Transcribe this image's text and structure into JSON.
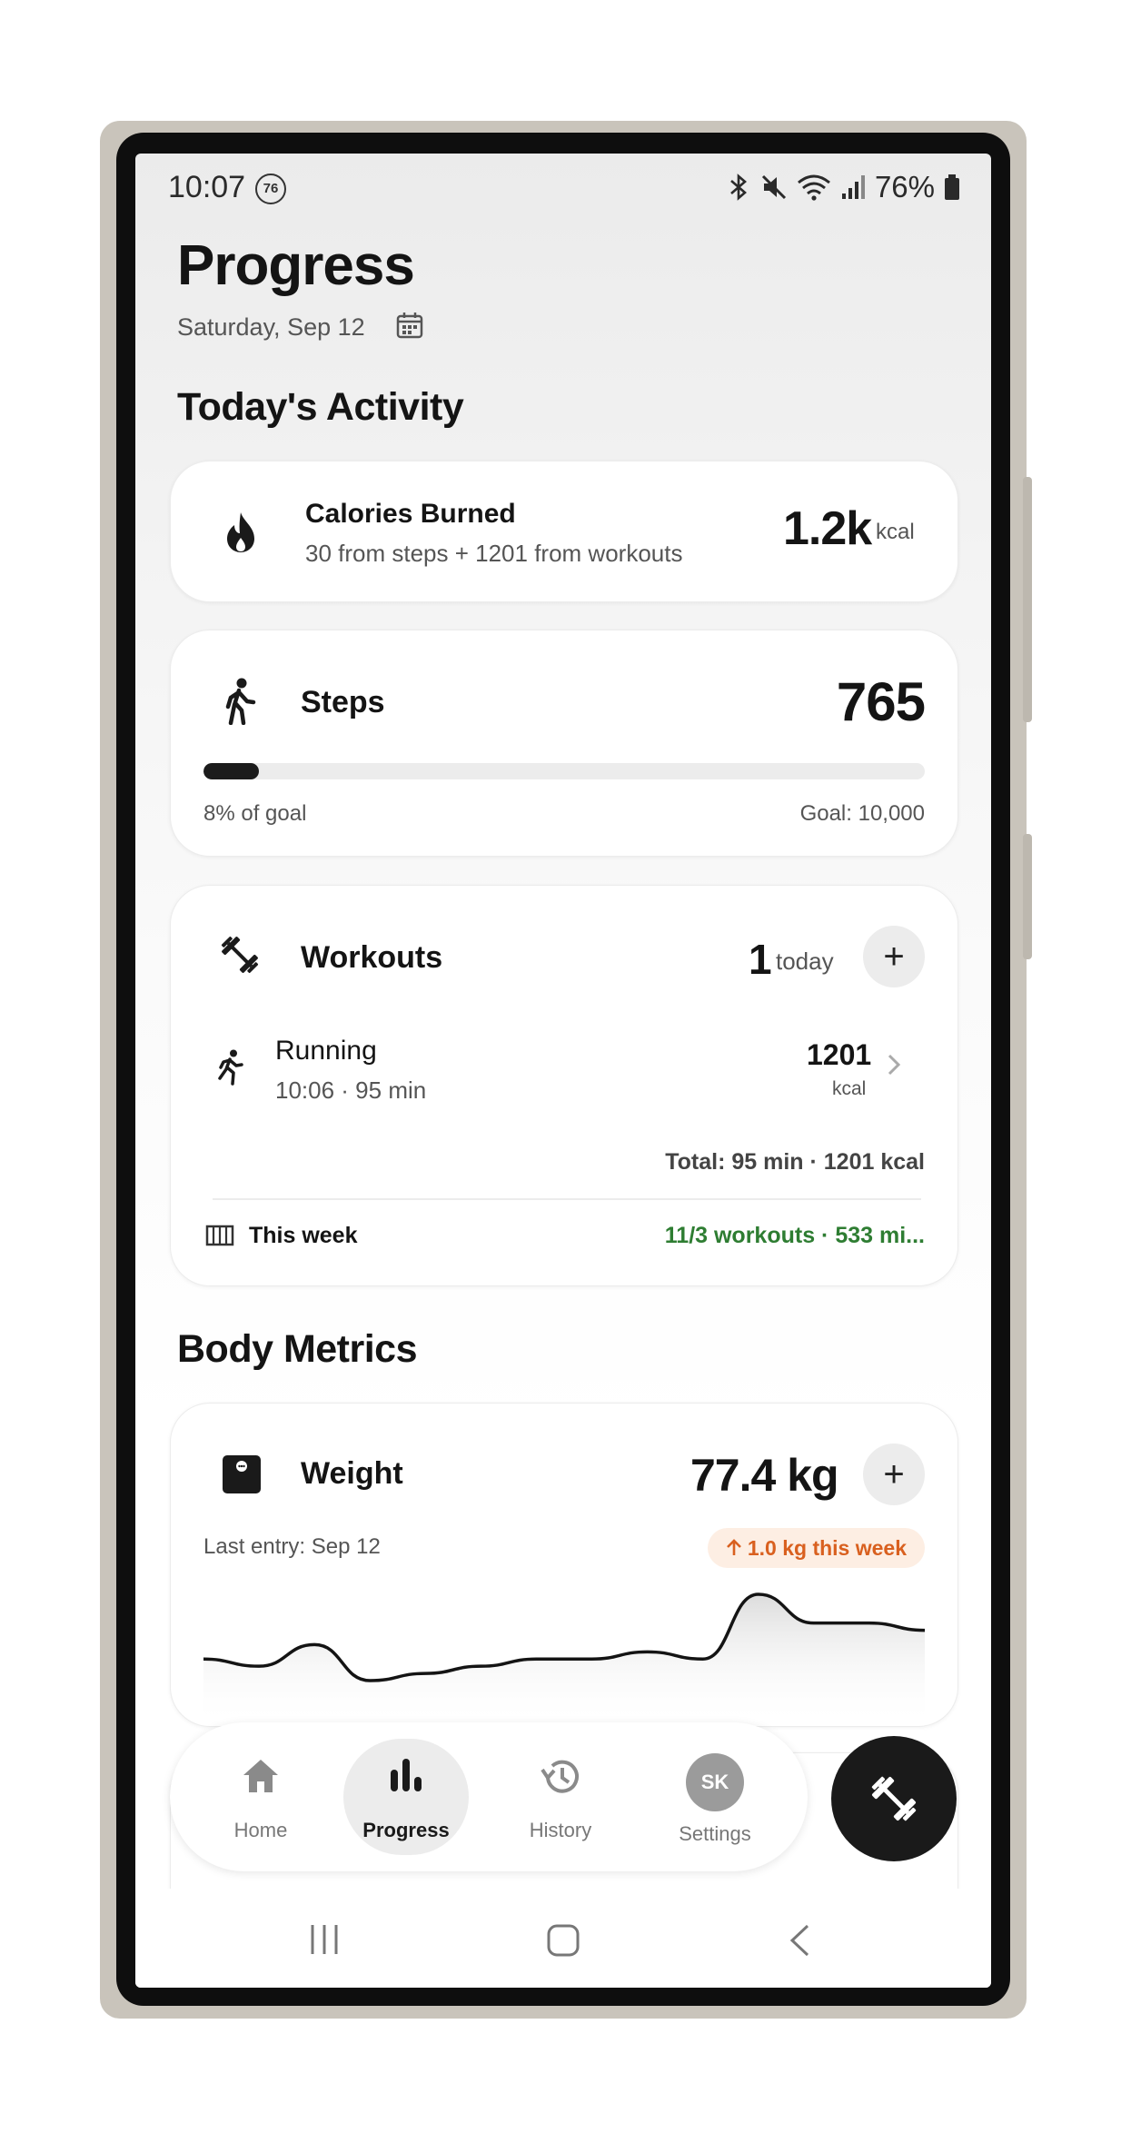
{
  "status_bar": {
    "time": "10:07",
    "badge": "76",
    "battery": "76%"
  },
  "header": {
    "title": "Progress",
    "date": "Saturday, Sep 12"
  },
  "sections": {
    "activity_title": "Today's Activity",
    "body_title": "Body Metrics"
  },
  "calories": {
    "title": "Calories Burned",
    "subtitle": "30 from steps + 1201 from workouts",
    "value": "1.2k",
    "unit": "kcal"
  },
  "steps": {
    "title": "Steps",
    "value": "765",
    "progress_fraction": 0.077,
    "progress_label": "8% of goal",
    "goal_label": "Goal: 10,000"
  },
  "workouts": {
    "title": "Workouts",
    "count": "1",
    "count_suffix": "today",
    "entry": {
      "name": "Running",
      "meta": "10:06 · 95 min",
      "kcal": "1201",
      "kcal_unit": "kcal"
    },
    "total": "Total: 95 min · 1201 kcal",
    "week_label": "This week",
    "week_summary": "11/3 workouts · 533 mi..."
  },
  "weight": {
    "title": "Weight",
    "value": "77.4 kg",
    "last_entry": "Last entry: Sep 12",
    "trend": "1.0 kg this week",
    "trend_color": "#d9601f",
    "series": [
      77.8,
      77.9,
      77.6,
      78.1,
      78.0,
      77.9,
      77.8,
      77.8,
      77.7,
      77.8,
      76.9,
      77.3,
      77.3,
      77.4
    ]
  },
  "nav": {
    "items": [
      {
        "label": "Home"
      },
      {
        "label": "Progress"
      },
      {
        "label": "History"
      },
      {
        "label": "Settings"
      }
    ],
    "avatar_initials": "SK"
  },
  "colors": {
    "accent_dark": "#1a1a1a",
    "green": "#2e7d32",
    "orange": "#d9601f"
  }
}
